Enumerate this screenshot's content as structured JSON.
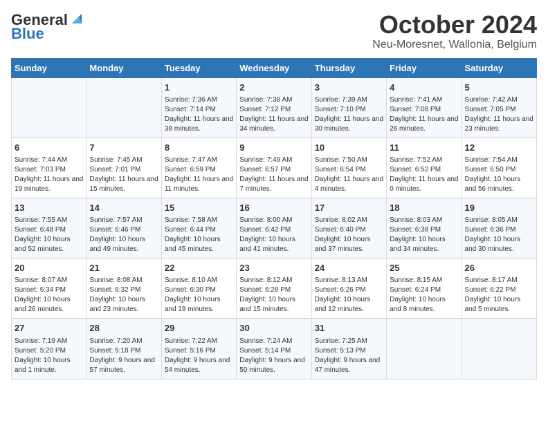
{
  "header": {
    "logo_line1": "General",
    "logo_line2": "Blue",
    "title": "October 2024",
    "subtitle": "Neu-Moresnet, Wallonia, Belgium"
  },
  "days_of_week": [
    "Sunday",
    "Monday",
    "Tuesday",
    "Wednesday",
    "Thursday",
    "Friday",
    "Saturday"
  ],
  "weeks": [
    [
      {
        "day": "",
        "info": ""
      },
      {
        "day": "",
        "info": ""
      },
      {
        "day": "1",
        "info": "Sunrise: 7:36 AM\nSunset: 7:14 PM\nDaylight: 11 hours and 38 minutes."
      },
      {
        "day": "2",
        "info": "Sunrise: 7:38 AM\nSunset: 7:12 PM\nDaylight: 11 hours and 34 minutes."
      },
      {
        "day": "3",
        "info": "Sunrise: 7:39 AM\nSunset: 7:10 PM\nDaylight: 11 hours and 30 minutes."
      },
      {
        "day": "4",
        "info": "Sunrise: 7:41 AM\nSunset: 7:08 PM\nDaylight: 11 hours and 26 minutes."
      },
      {
        "day": "5",
        "info": "Sunrise: 7:42 AM\nSunset: 7:05 PM\nDaylight: 11 hours and 23 minutes."
      }
    ],
    [
      {
        "day": "6",
        "info": "Sunrise: 7:44 AM\nSunset: 7:03 PM\nDaylight: 11 hours and 19 minutes."
      },
      {
        "day": "7",
        "info": "Sunrise: 7:45 AM\nSunset: 7:01 PM\nDaylight: 11 hours and 15 minutes."
      },
      {
        "day": "8",
        "info": "Sunrise: 7:47 AM\nSunset: 6:59 PM\nDaylight: 11 hours and 11 minutes."
      },
      {
        "day": "9",
        "info": "Sunrise: 7:49 AM\nSunset: 6:57 PM\nDaylight: 11 hours and 7 minutes."
      },
      {
        "day": "10",
        "info": "Sunrise: 7:50 AM\nSunset: 6:54 PM\nDaylight: 11 hours and 4 minutes."
      },
      {
        "day": "11",
        "info": "Sunrise: 7:52 AM\nSunset: 6:52 PM\nDaylight: 11 hours and 0 minutes."
      },
      {
        "day": "12",
        "info": "Sunrise: 7:54 AM\nSunset: 6:50 PM\nDaylight: 10 hours and 56 minutes."
      }
    ],
    [
      {
        "day": "13",
        "info": "Sunrise: 7:55 AM\nSunset: 6:48 PM\nDaylight: 10 hours and 52 minutes."
      },
      {
        "day": "14",
        "info": "Sunrise: 7:57 AM\nSunset: 6:46 PM\nDaylight: 10 hours and 49 minutes."
      },
      {
        "day": "15",
        "info": "Sunrise: 7:58 AM\nSunset: 6:44 PM\nDaylight: 10 hours and 45 minutes."
      },
      {
        "day": "16",
        "info": "Sunrise: 8:00 AM\nSunset: 6:42 PM\nDaylight: 10 hours and 41 minutes."
      },
      {
        "day": "17",
        "info": "Sunrise: 8:02 AM\nSunset: 6:40 PM\nDaylight: 10 hours and 37 minutes."
      },
      {
        "day": "18",
        "info": "Sunrise: 8:03 AM\nSunset: 6:38 PM\nDaylight: 10 hours and 34 minutes."
      },
      {
        "day": "19",
        "info": "Sunrise: 8:05 AM\nSunset: 6:36 PM\nDaylight: 10 hours and 30 minutes."
      }
    ],
    [
      {
        "day": "20",
        "info": "Sunrise: 8:07 AM\nSunset: 6:34 PM\nDaylight: 10 hours and 26 minutes."
      },
      {
        "day": "21",
        "info": "Sunrise: 8:08 AM\nSunset: 6:32 PM\nDaylight: 10 hours and 23 minutes."
      },
      {
        "day": "22",
        "info": "Sunrise: 8:10 AM\nSunset: 6:30 PM\nDaylight: 10 hours and 19 minutes."
      },
      {
        "day": "23",
        "info": "Sunrise: 8:12 AM\nSunset: 6:28 PM\nDaylight: 10 hours and 15 minutes."
      },
      {
        "day": "24",
        "info": "Sunrise: 8:13 AM\nSunset: 6:26 PM\nDaylight: 10 hours and 12 minutes."
      },
      {
        "day": "25",
        "info": "Sunrise: 8:15 AM\nSunset: 6:24 PM\nDaylight: 10 hours and 8 minutes."
      },
      {
        "day": "26",
        "info": "Sunrise: 8:17 AM\nSunset: 6:22 PM\nDaylight: 10 hours and 5 minutes."
      }
    ],
    [
      {
        "day": "27",
        "info": "Sunrise: 7:19 AM\nSunset: 5:20 PM\nDaylight: 10 hours and 1 minute."
      },
      {
        "day": "28",
        "info": "Sunrise: 7:20 AM\nSunset: 5:18 PM\nDaylight: 9 hours and 57 minutes."
      },
      {
        "day": "29",
        "info": "Sunrise: 7:22 AM\nSunset: 5:16 PM\nDaylight: 9 hours and 54 minutes."
      },
      {
        "day": "30",
        "info": "Sunrise: 7:24 AM\nSunset: 5:14 PM\nDaylight: 9 hours and 50 minutes."
      },
      {
        "day": "31",
        "info": "Sunrise: 7:25 AM\nSunset: 5:13 PM\nDaylight: 9 hours and 47 minutes."
      },
      {
        "day": "",
        "info": ""
      },
      {
        "day": "",
        "info": ""
      }
    ]
  ]
}
